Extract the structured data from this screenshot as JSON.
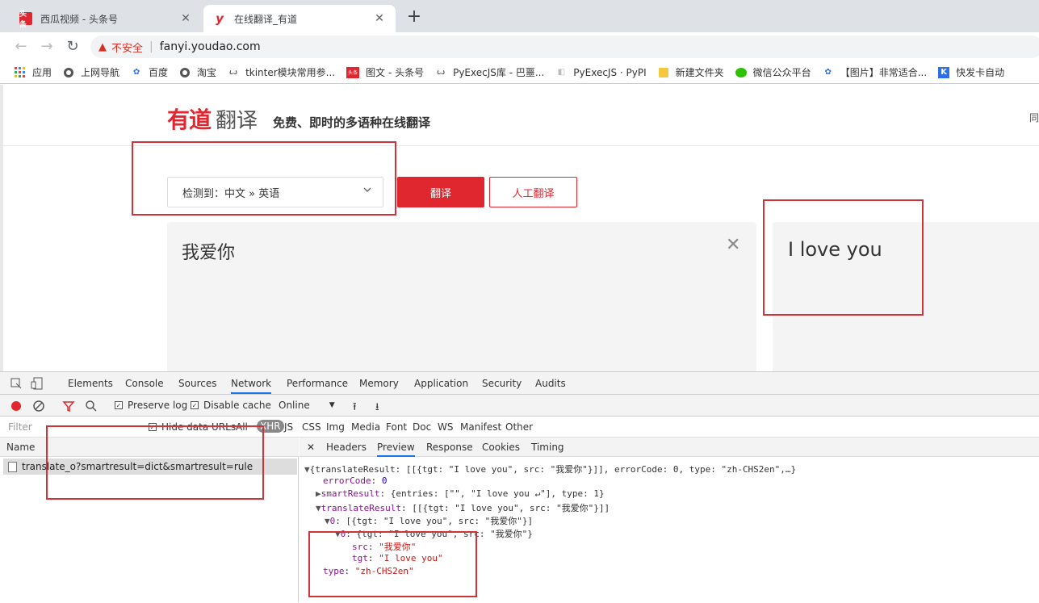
{
  "browser": {
    "tabs": [
      {
        "title": "西瓜视频 - 头条号",
        "favicon": "头条",
        "active": false
      },
      {
        "title": "在线翻译_有道",
        "favicon": "y",
        "active": true
      }
    ],
    "new_tab_label": "+",
    "close_label": "✕",
    "security_label": "不安全",
    "url": "fanyi.youdao.com",
    "bookmarks": [
      {
        "label": "应用",
        "icon": "apps-grid-icon"
      },
      {
        "label": "上网导航",
        "icon": "globe-icon"
      },
      {
        "label": "百度",
        "icon": "baidu-paw-icon"
      },
      {
        "label": "淘宝",
        "icon": "globe-icon"
      },
      {
        "label": "tkinter模块常用参...",
        "icon": "link-icon"
      },
      {
        "label": "图文 - 头条号",
        "icon": "toutiao-icon"
      },
      {
        "label": "PyExecJS库 - 巴噩...",
        "icon": "link-icon"
      },
      {
        "label": "PyExecJS · PyPI",
        "icon": "pypi-icon"
      },
      {
        "label": "新建文件夹",
        "icon": "folder-icon"
      },
      {
        "label": "微信公众平台",
        "icon": "wechat-icon"
      },
      {
        "label": "【图片】非常适合...",
        "icon": "baidu-paw-icon"
      },
      {
        "label": "快发卡自动",
        "icon": "k-icon"
      }
    ]
  },
  "page": {
    "logo_main": "有道",
    "logo_sub": "翻译",
    "slogan": "免费、即时的多语种在线翻译",
    "header_right": "同",
    "lang_select": "检测到：中文 » 英语",
    "translate_button": "翻译",
    "human_translate_button": "人工翻译",
    "source_text": "我爱你",
    "clear_label": "✕",
    "target_text": "I love you"
  },
  "devtools": {
    "tabs": [
      "Elements",
      "Console",
      "Sources",
      "Network",
      "Performance",
      "Memory",
      "Application",
      "Security",
      "Audits"
    ],
    "active_tab": "Network",
    "preserve_log": "Preserve log",
    "disable_cache": "Disable cache",
    "throttle": "Online",
    "filter_placeholder": "Filter",
    "hide_data_urls": "Hide data URLs",
    "filter_types": [
      "All",
      "XHR",
      "JS",
      "CSS",
      "Img",
      "Media",
      "Font",
      "Doc",
      "WS",
      "Manifest",
      "Other"
    ],
    "selected_filter": "XHR",
    "name_header": "Name",
    "request_name": "translate_o?smartresult=dict&smartresult=rule",
    "detail_tabs": [
      "Headers",
      "Preview",
      "Response",
      "Cookies",
      "Timing"
    ],
    "active_detail_tab": "Preview",
    "detail_close": "✕",
    "preview_lines": {
      "l1": "{translateResult: [[{tgt: \"I love you\", src: \"我爱你\"}]], errorCode: 0, type: \"zh-CHS2en\",…}",
      "l2_key": "errorCode",
      "l2_val": "0",
      "l3_key": "smartResult",
      "l3_val": "{entries: [\"\", \"I love you ↵\"], type: 1}",
      "l4_key": "translateResult",
      "l4_val": "[[{tgt: \"I love you\", src: \"我爱你\"}]]",
      "l5_key": "0",
      "l5_val": "[{tgt: \"I love you\", src: \"我爱你\"}]",
      "l6_key": "0",
      "l6_val": "{tgt: \"I love you\", src: \"我爱你\"}",
      "l7_key": "src",
      "l7_val": "\"我爱你\"",
      "l8_key": "tgt",
      "l8_val": "\"I love you\"",
      "l9_key": "type",
      "l9_val": "\"zh-CHS2en\""
    }
  },
  "colors": {
    "brand_red": "#e0262f",
    "annotation_red": "#d0343b",
    "devtools_active": "#1a73e8"
  }
}
